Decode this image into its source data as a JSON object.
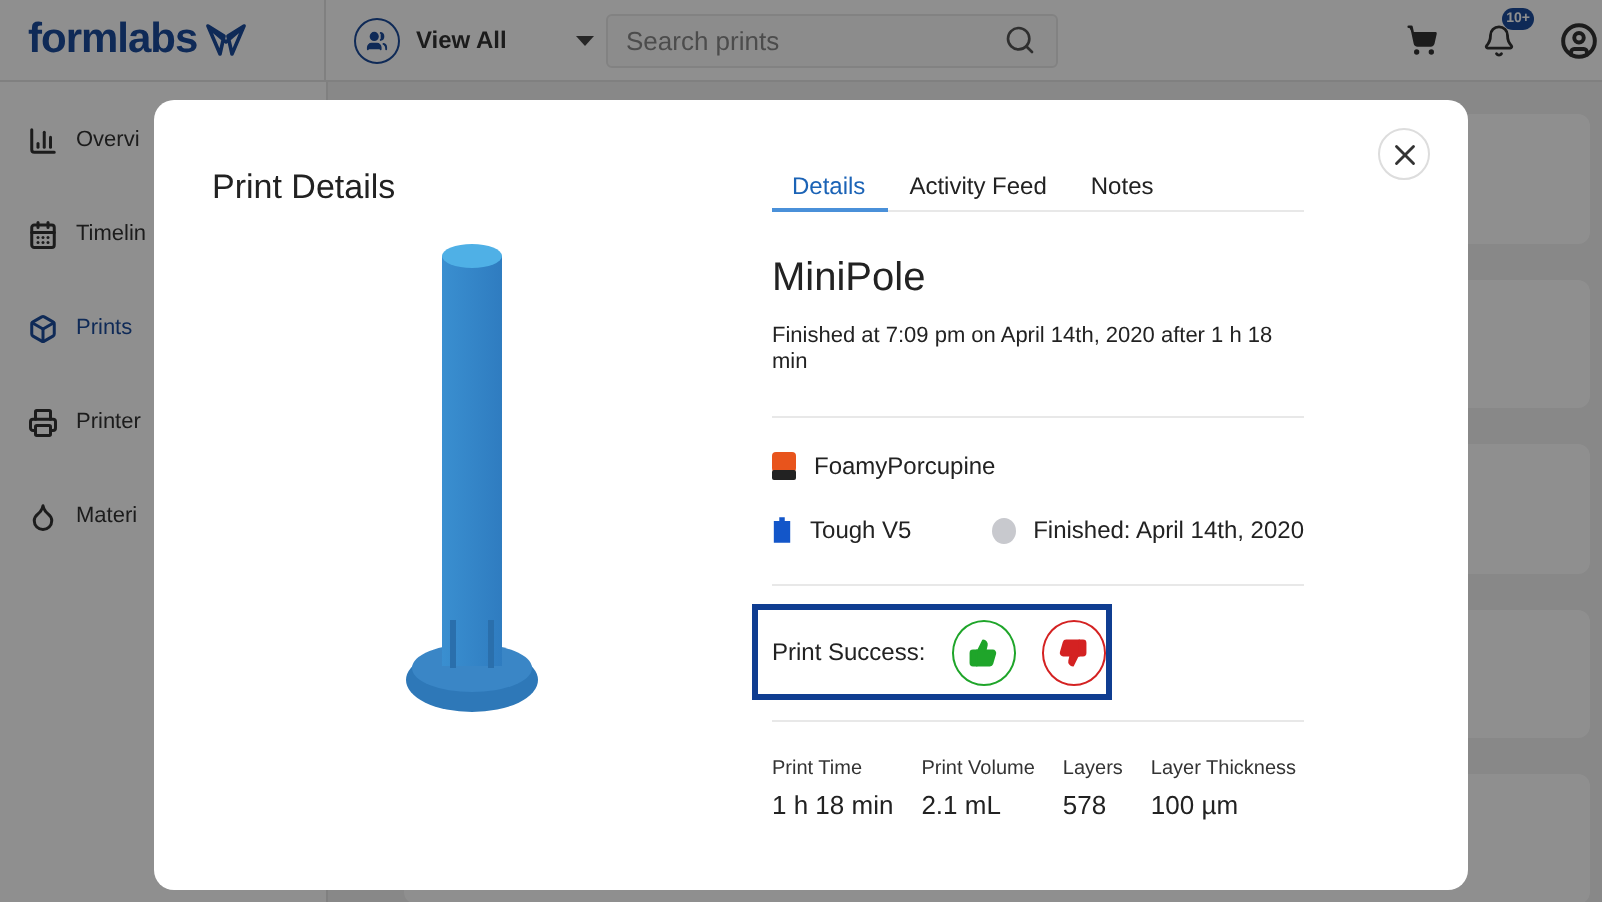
{
  "header": {
    "logo": "formlabs",
    "view_filter": {
      "label": "View All"
    },
    "search": {
      "placeholder": "Search prints"
    },
    "notifications": {
      "badge": "10+"
    }
  },
  "sidebar": {
    "items": [
      {
        "label": "Overvi",
        "selected": false
      },
      {
        "label": "Timelin",
        "selected": false
      },
      {
        "label": "Prints",
        "selected": true
      },
      {
        "label": "Printer",
        "selected": false
      },
      {
        "label": "Materi",
        "selected": false
      }
    ]
  },
  "modal": {
    "title": "Print Details",
    "tabs": [
      {
        "label": "Details",
        "selected": true
      },
      {
        "label": "Activity Feed",
        "selected": false
      },
      {
        "label": "Notes",
        "selected": false
      }
    ],
    "name": "MiniPole",
    "finished_text": "Finished at 7:09 pm on April 14th, 2020 after 1 h 18 min",
    "printer": "FoamyPorcupine",
    "material": "Tough V5",
    "status": {
      "label": "Finished: April 14th, 2020",
      "color": "#c8c9ce"
    },
    "print_success": {
      "label": "Print Success:"
    },
    "stats": [
      {
        "label": "Print Time",
        "value": "1 h 18 min"
      },
      {
        "label": "Print Volume",
        "value": "2.1 mL"
      },
      {
        "label": "Layers",
        "value": "578"
      },
      {
        "label": "Layer Thickness",
        "value": "100 µm"
      }
    ]
  }
}
